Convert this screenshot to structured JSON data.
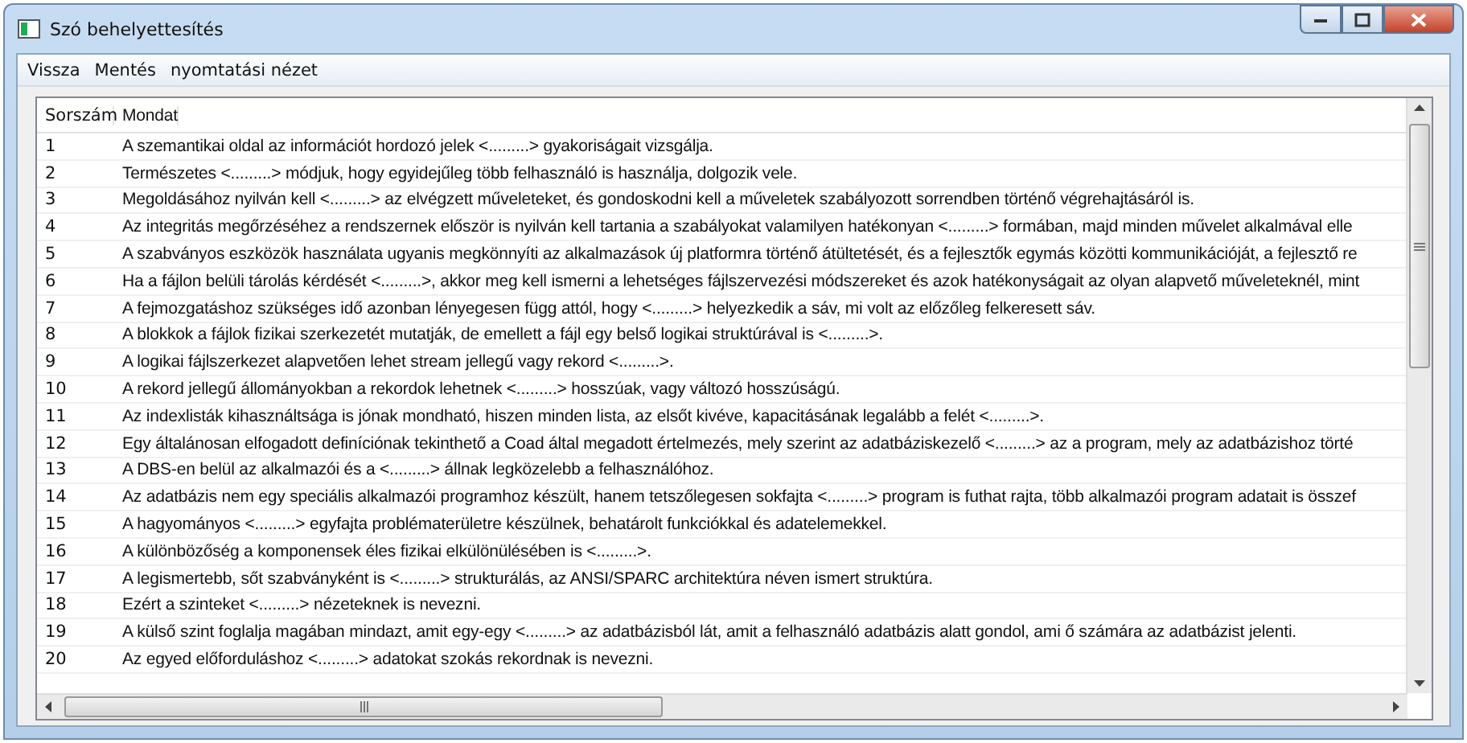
{
  "window": {
    "title": "Szó behelyettesítés"
  },
  "menu": [
    "Vissza",
    "Mentés",
    "nyomtatási nézet"
  ],
  "table": {
    "columns": [
      "Sorszám",
      "Mondat"
    ],
    "rows": [
      [
        "1",
        "A szemantikai oldal az információt hordozó jelek <.........> gyakoriságait vizsgálja."
      ],
      [
        "2",
        "Természetes <.........> módjuk, hogy egyidejűleg több felhasználó is használja, dolgozik vele."
      ],
      [
        "3",
        "Megoldásához nyilván kell <.........> az elvégzett műveleteket, és gondoskodni kell a műveletek szabályozott sorrendben történő végrehajtásáról is."
      ],
      [
        "4",
        "Az integritás megőrzéséhez a rendszernek először is nyilván kell tartania a szabályokat valamilyen hatékonyan <.........> formában, majd minden művelet alkalmával elle"
      ],
      [
        "5",
        "A szabványos eszközök használata ugyanis megkönnyíti az alkalmazások új platformra történő átültetését, és a fejlesztők egymás közötti kommunikációját, a fejlesztő re"
      ],
      [
        "6",
        "Ha a fájlon belüli tárolás kérdését <.........>, akkor meg kell ismerni a lehetséges fájlszervezési módszereket és azok hatékonyságait az olyan alapvető műveleteknél, mint"
      ],
      [
        "7",
        "A fejmozgatáshoz szükséges idő azonban lényegesen függ attól, hogy <.........> helyezkedik a sáv, mi volt az előzőleg felkeresett sáv."
      ],
      [
        "8",
        "A blokkok a fájlok fizikai szerkezetét mutatják, de emellett a fájl egy belső logikai struktúrával is <.........>."
      ],
      [
        "9",
        "A logikai fájlszerkezet alapvetően lehet stream jellegű vagy rekord <.........>."
      ],
      [
        "10",
        "A rekord jellegű állományokban a rekordok lehetnek <.........> hosszúak, vagy változó hosszúságú."
      ],
      [
        "11",
        "Az indexlisták kihasználtsága is jónak mondható, hiszen minden lista, az elsőt kivéve, kapacitásának legalább a felét <.........>."
      ],
      [
        "12",
        "Egy általánosan elfogadott definíciónak tekinthető a Coad által megadott értelmezés, mely szerint az adatbáziskezelő <.........> az a program, mely az adatbázishoz törté"
      ],
      [
        "13",
        "A DBS-en belül az alkalmazói és a <.........> állnak legközelebb a felhasználóhoz."
      ],
      [
        "14",
        "Az adatbázis nem egy speciális alkalmazói programhoz készült, hanem tetszőlegesen sokfajta <.........> program is futhat rajta, több alkalmazói program adatait is összef"
      ],
      [
        "15",
        "A hagyományos <.........> egyfajta problématerületre készülnek, behatárolt funkciókkal és adatelemekkel."
      ],
      [
        "16",
        "A különbözőség a komponensek éles fizikai elkülönülésében is <.........>."
      ],
      [
        "17",
        "A legismertebb, sőt szabványként is <.........> strukturálás, az ANSI/SPARC architektúra néven ismert struktúra."
      ],
      [
        "18",
        "Ezért a szinteket <.........> nézeteknek is nevezni."
      ],
      [
        "19",
        "A külső szint foglalja magában mindazt, amit egy-egy <.........> az adatbázisból lát, amit a felhasználó adatbázis alatt gondol, ami ő számára az adatbázist jelenti."
      ],
      [
        "20",
        "Az egyed előforduláshoz <.........> adatokat szokás rekordnak is nevezni."
      ]
    ]
  }
}
